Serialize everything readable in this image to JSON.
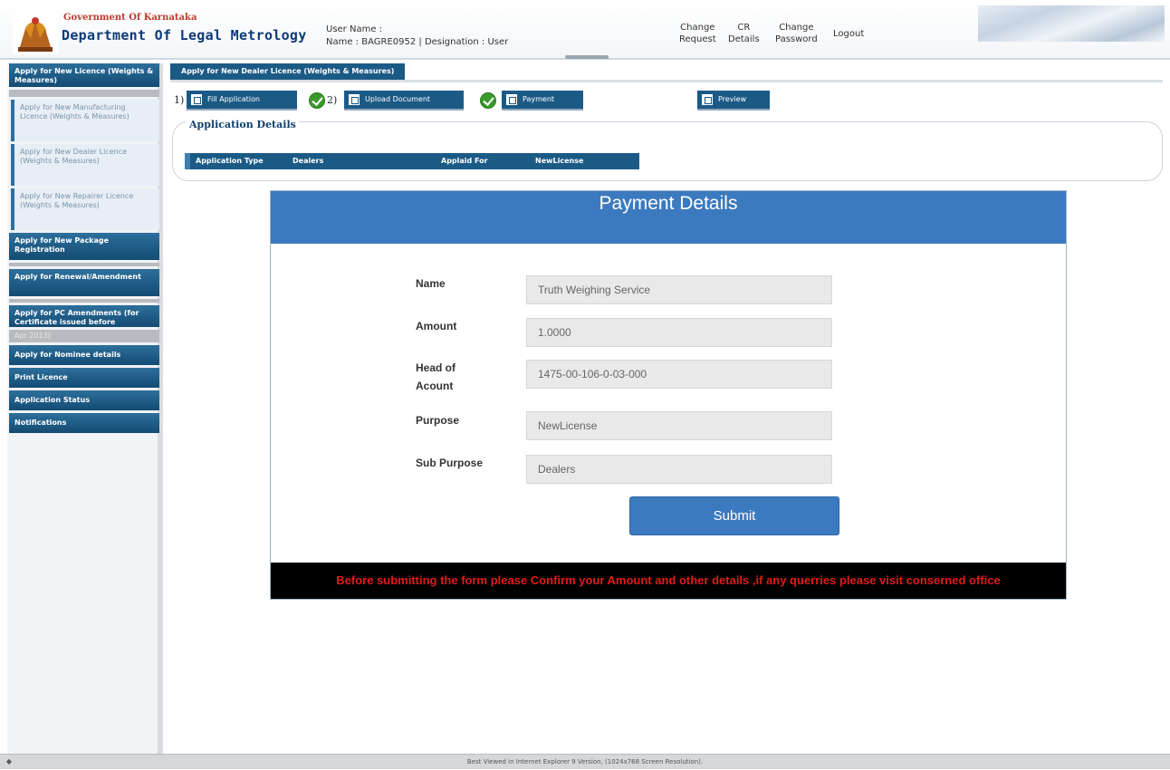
{
  "header": {
    "gov_name": "Government Of Karnataka",
    "dept_name": "Department Of Legal Metrology",
    "user_name_line": "User Name :",
    "user_details_line": "Name : BAGRE0952 | Designation : User",
    "nav": {
      "change_request": [
        "Change",
        "Request"
      ],
      "cr_details": [
        "CR",
        "Details"
      ],
      "change_password": [
        "Change",
        "Password"
      ],
      "logout": "Logout"
    }
  },
  "sidebar": {
    "items": [
      {
        "label": "Apply for New Licence (Weights & Measures)"
      },
      {
        "label": "Apply for New Manufacturing Licence (Weights & Measures)"
      },
      {
        "label": "Apply for New Dealer Licence (Weights & Measures)"
      },
      {
        "label": "Apply for New Repairer Licence (Weights & Measures)"
      },
      {
        "label": "Apply for New Package Registration"
      },
      {
        "label": "Apply for Renewal/Amendment"
      },
      {
        "label": "Apply for PC Amendments (for Certificate issued before"
      },
      {
        "label": "Apply for Nominee details"
      },
      {
        "label": "Print Licence"
      },
      {
        "label": "Application Status"
      },
      {
        "label": "Notifications"
      }
    ],
    "faded_label": "Apr 2013)"
  },
  "page_tab": "Apply for New Dealer Licence (Weights & Measures)",
  "steps": {
    "step1_num": "1)",
    "step1_label": "Fill Application",
    "step2_num": "2)",
    "step2_label": "Upload Document",
    "step3_label": "Payment",
    "preview_label": "Preview"
  },
  "application_details": {
    "title": "Application Details",
    "type_label": "Application Type",
    "type_value": "Dealers",
    "applied_label": "Applaid For",
    "applied_value": "NewLicense"
  },
  "payment": {
    "title": "Payment Details",
    "fields": [
      {
        "label": "Name",
        "value": "Truth Weighing Service"
      },
      {
        "label": "Amount",
        "value": "1.0000"
      },
      {
        "label": "Head of Acount",
        "value": "1475-00-106-0-03-000"
      },
      {
        "label": "Purpose",
        "value": "NewLicense"
      },
      {
        "label": "Sub Purpose",
        "value": "Dealers"
      }
    ],
    "submit_label": "Submit",
    "warning": "Before submitting the form please Confirm your Amount and other details ,if any querries please visit conserned office"
  },
  "footer": {
    "text": "Best Viewed in Internet Explorer 9 Version, (1024x768 Screen Resolution).",
    "dot": "◆"
  },
  "colors": {
    "nav_blue": "#1c5a86",
    "panel_blue": "#3c7abf",
    "warning_red": "#e21b1b",
    "check_green": "#3a9a2b"
  }
}
